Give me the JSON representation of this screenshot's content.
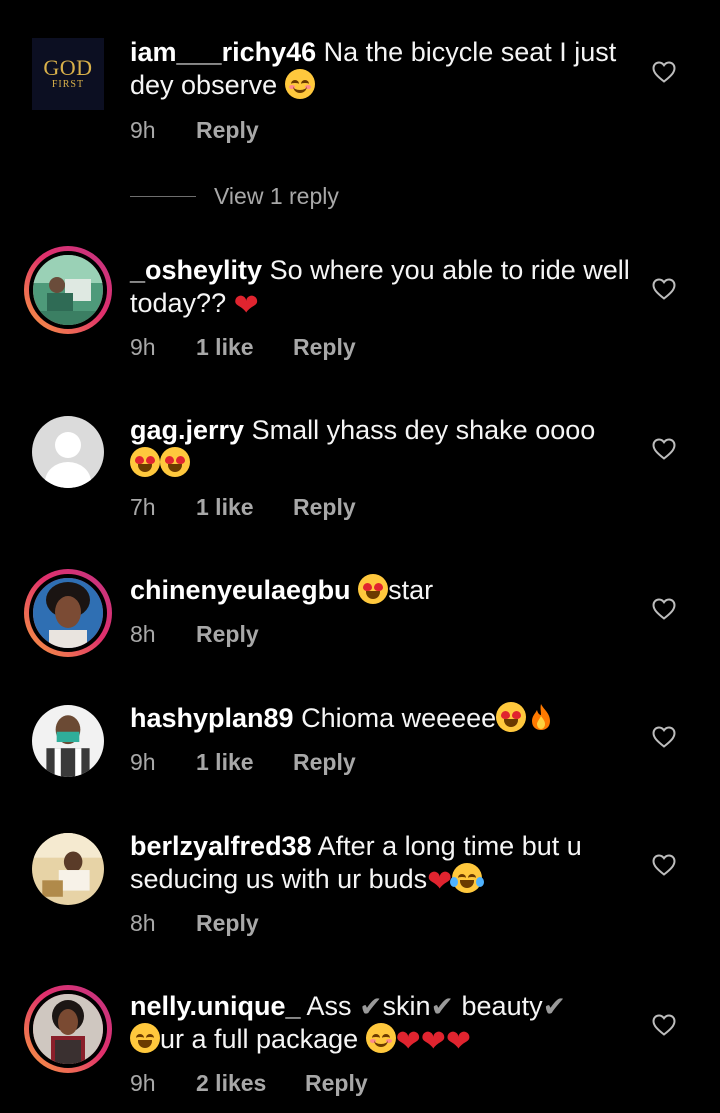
{
  "comments": [
    {
      "username": "iam___richy46",
      "text": " Na the bicycle seat I just dey observe ",
      "time": "9h",
      "likes": "",
      "reply": "Reply",
      "avatar_text_top": "GOD",
      "avatar_text_bottom": "FIRST"
    },
    {
      "username": "_osheylity",
      "text": " So where you able to ride well today?? ",
      "time": "9h",
      "likes": "1 like",
      "reply": "Reply"
    },
    {
      "username": "gag.jerry",
      "text": " Small yhass dey shake oooo",
      "time": "7h",
      "likes": "1 like",
      "reply": "Reply"
    },
    {
      "username": "chinenyeulaegbu",
      "text": "star",
      "time": "8h",
      "likes": "",
      "reply": "Reply"
    },
    {
      "username": "hashyplan89",
      "text": " Chioma weeeee",
      "time": "9h",
      "likes": "1 like",
      "reply": "Reply"
    },
    {
      "username": "berlzyalfred38",
      "text": " After a long time but u seducing us with ur buds",
      "time": "8h",
      "likes": "",
      "reply": "Reply"
    },
    {
      "username": "nelly.unique_",
      "text_a": " Ass ",
      "text_b": "skin",
      "text_c": " beauty",
      "text_d": "ur a full package ",
      "time": "9h",
      "likes": "2 likes",
      "reply": "Reply"
    }
  ],
  "view_replies": "View 1 reply",
  "icons": {
    "like": "heart-outline-icon",
    "check": "heavy-check-mark"
  },
  "colors": {
    "background": "#000000",
    "meta_text": "#a8a8a8",
    "story_ring_start": "#f9a03f",
    "story_ring_end": "#c13584"
  }
}
